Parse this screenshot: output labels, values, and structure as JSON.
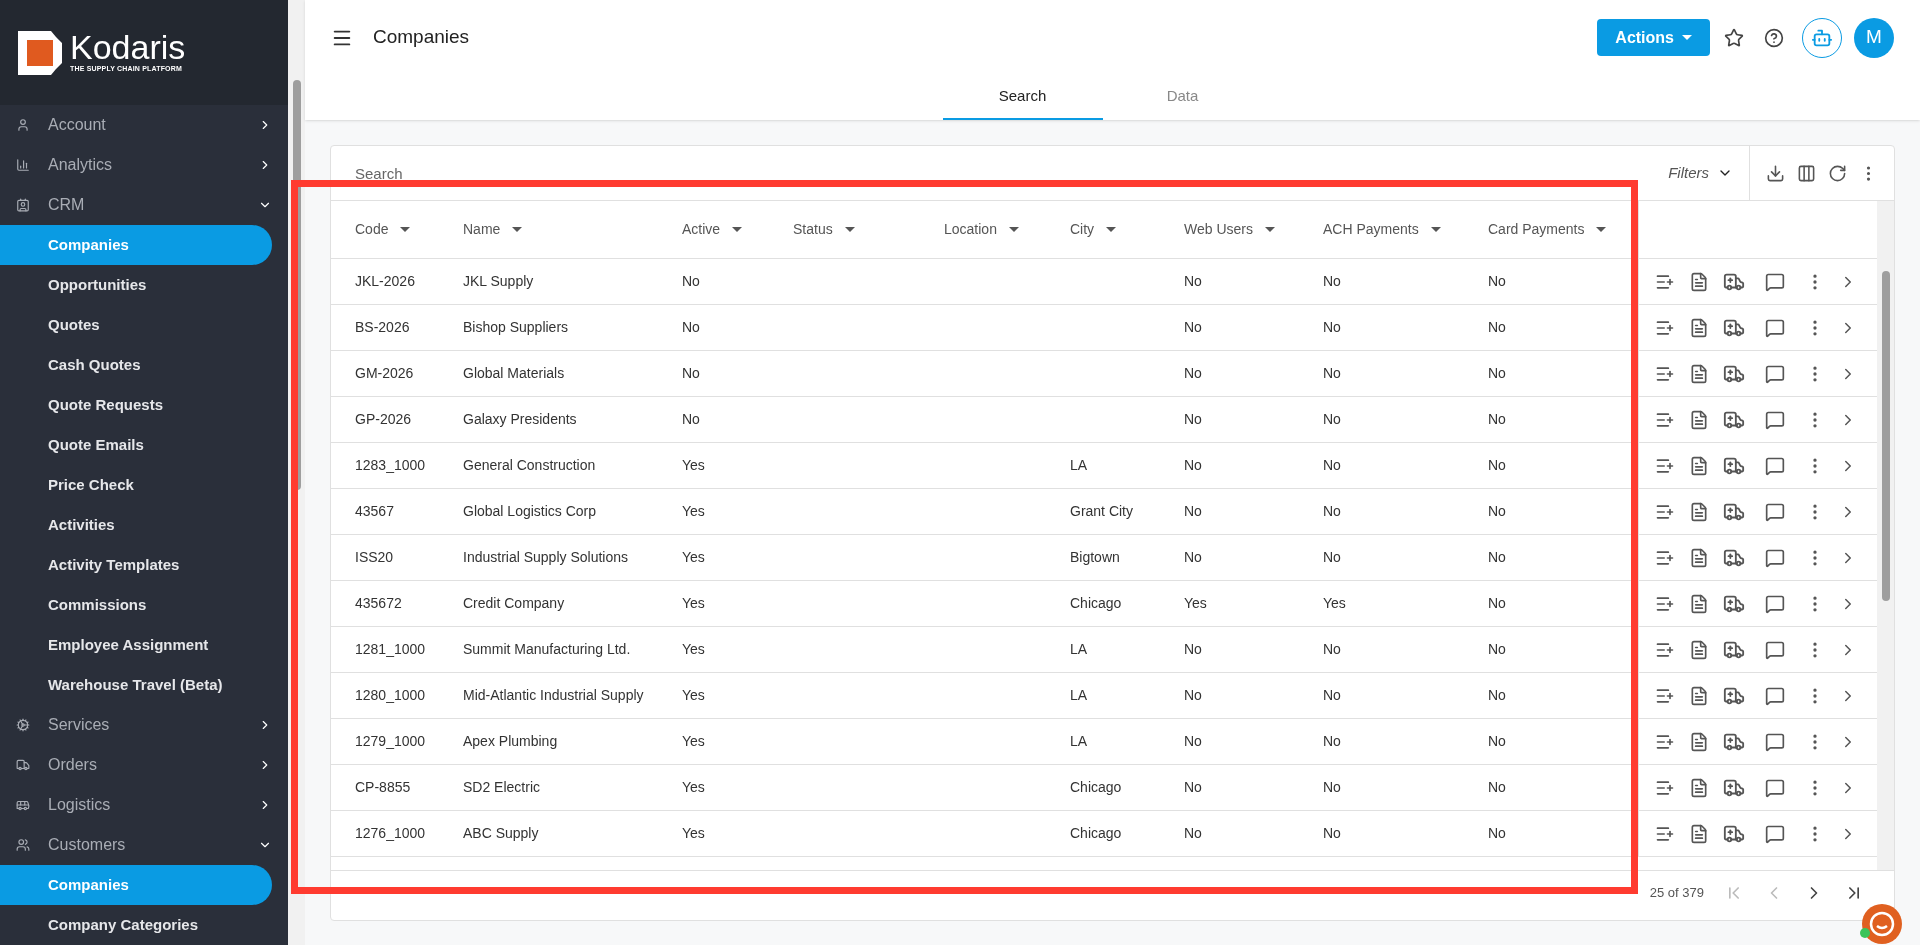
{
  "sidebar": {
    "brand": "Kodaris",
    "tagline": "THE SUPPLY CHAIN PLATFORM",
    "items": [
      {
        "label": "Account",
        "expanded": false
      },
      {
        "label": "Analytics",
        "expanded": false
      },
      {
        "label": "CRM",
        "expanded": true,
        "children": [
          {
            "label": "Companies",
            "selected": true
          },
          {
            "label": "Opportunities",
            "selected": false
          },
          {
            "label": "Quotes",
            "selected": false
          },
          {
            "label": "Cash Quotes",
            "selected": false
          },
          {
            "label": "Quote Requests",
            "selected": false
          },
          {
            "label": "Quote Emails",
            "selected": false
          },
          {
            "label": "Price Check",
            "selected": false
          },
          {
            "label": "Activities",
            "selected": false
          },
          {
            "label": "Activity Templates",
            "selected": false
          },
          {
            "label": "Commissions",
            "selected": false
          },
          {
            "label": "Employee Assignment",
            "selected": false
          },
          {
            "label": "Warehouse Travel (Beta)",
            "selected": false
          }
        ]
      },
      {
        "label": "Services",
        "expanded": false
      },
      {
        "label": "Orders",
        "expanded": false
      },
      {
        "label": "Logistics",
        "expanded": false
      },
      {
        "label": "Customers",
        "expanded": true,
        "children": [
          {
            "label": "Companies",
            "selected": true
          },
          {
            "label": "Company Categories",
            "selected": false
          }
        ]
      }
    ]
  },
  "header": {
    "title": "Companies",
    "actions_button": "Actions",
    "avatar": "M"
  },
  "tabs": [
    {
      "label": "Search",
      "selected": true
    },
    {
      "label": "Data",
      "selected": false
    }
  ],
  "toolbar": {
    "search_placeholder": "Search",
    "filters": "Filters"
  },
  "table": {
    "columns": [
      "Code",
      "Name",
      "Active",
      "Status",
      "Location",
      "City",
      "Web Users",
      "ACH Payments",
      "Card Payments"
    ],
    "rows": [
      [
        "JKL-2026",
        "JKL Supply",
        "No",
        "",
        "",
        "",
        "No",
        "No",
        "No"
      ],
      [
        "BS-2026",
        "Bishop Suppliers",
        "No",
        "",
        "",
        "",
        "No",
        "No",
        "No"
      ],
      [
        "GM-2026",
        "Global Materials",
        "No",
        "",
        "",
        "",
        "No",
        "No",
        "No"
      ],
      [
        "GP-2026",
        "Galaxy Presidents",
        "No",
        "",
        "",
        "",
        "No",
        "No",
        "No"
      ],
      [
        "1283_1000",
        "General Construction",
        "Yes",
        "",
        "",
        "LA",
        "No",
        "No",
        "No"
      ],
      [
        "43567",
        "Global Logistics Corp",
        "Yes",
        "",
        "",
        "Grant City",
        "No",
        "No",
        "No"
      ],
      [
        "ISS20",
        "Industrial Supply Solutions",
        "Yes",
        "",
        "",
        "Bigtown",
        "No",
        "No",
        "No"
      ],
      [
        "435672",
        "Credit Company",
        "Yes",
        "",
        "",
        "Chicago",
        "Yes",
        "Yes",
        "No"
      ],
      [
        "1281_1000",
        "Summit Manufacturing Ltd.",
        "Yes",
        "",
        "",
        "LA",
        "No",
        "No",
        "No"
      ],
      [
        "1280_1000",
        "Mid-Atlantic Industrial Supply",
        "Yes",
        "",
        "",
        "LA",
        "No",
        "No",
        "No"
      ],
      [
        "1279_1000",
        "Apex Plumbing",
        "Yes",
        "",
        "",
        "LA",
        "No",
        "No",
        "No"
      ],
      [
        "CP-8855",
        "SD2 Electric",
        "Yes",
        "",
        "",
        "Chicago",
        "No",
        "No",
        "No"
      ],
      [
        "1276_1000",
        "ABC Supply",
        "Yes",
        "",
        "",
        "Chicago",
        "No",
        "No",
        "No"
      ]
    ]
  },
  "pagination": {
    "range": "25 of 379"
  }
}
